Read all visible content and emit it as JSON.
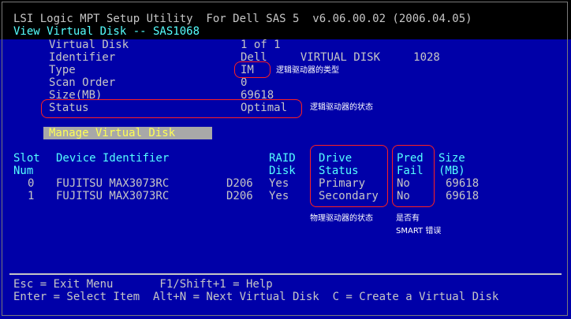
{
  "header": {
    "title": "LSI Logic MPT Setup Utility  For Dell SAS 5  v6.06.00.02 (2006.04.05)",
    "subtitle": "View Virtual Disk -- SAS1068"
  },
  "properties": [
    {
      "label": "Virtual Disk",
      "value": "1 of 1"
    },
    {
      "label": "Identifier",
      "value": "Dell     VIRTUAL DISK     1028"
    },
    {
      "label": "Type",
      "value": "IM"
    },
    {
      "label": "Scan Order",
      "value": "0"
    },
    {
      "label": "Size(MB)",
      "value": "69618"
    },
    {
      "label": "Status",
      "value": "Optimal"
    }
  ],
  "manage_label": "Manage Virtual Disk",
  "table": {
    "headers": {
      "slot": [
        "Slot",
        "Num"
      ],
      "device": "Device Identifier",
      "raid": [
        "RAID",
        "Disk"
      ],
      "drive_status": [
        "Drive",
        "Status"
      ],
      "pred_fail": [
        "Pred",
        "Fail"
      ],
      "size": [
        "Size",
        "(MB)"
      ]
    },
    "rows": [
      {
        "slot": "0",
        "device": "FUJITSU MAX3073RC",
        "rev": "D206",
        "raid": "Yes",
        "status": "Primary",
        "pred": "No",
        "size": "69618"
      },
      {
        "slot": "1",
        "device": "FUJITSU MAX3073RC",
        "rev": "D206",
        "raid": "Yes",
        "status": "Secondary",
        "pred": "No",
        "size": "69618"
      }
    ]
  },
  "annotations": {
    "type": "逻辑驱动器的类型",
    "status": "逻辑驱动器的状态",
    "drive_status": "物理驱动器的状态",
    "pred_fail_1": "是否有",
    "pred_fail_2": "SMART 错误"
  },
  "footer": {
    "line1": "Esc = Exit Menu       F1/Shift+1 = Help",
    "line2": "Enter = Select Item  Alt+N = Next Virtual Disk  C = Create a Virtual Disk"
  },
  "colors": {
    "background": "#0000a8",
    "annotation_outline": "#ff2020",
    "highlight": "#ffff55"
  }
}
